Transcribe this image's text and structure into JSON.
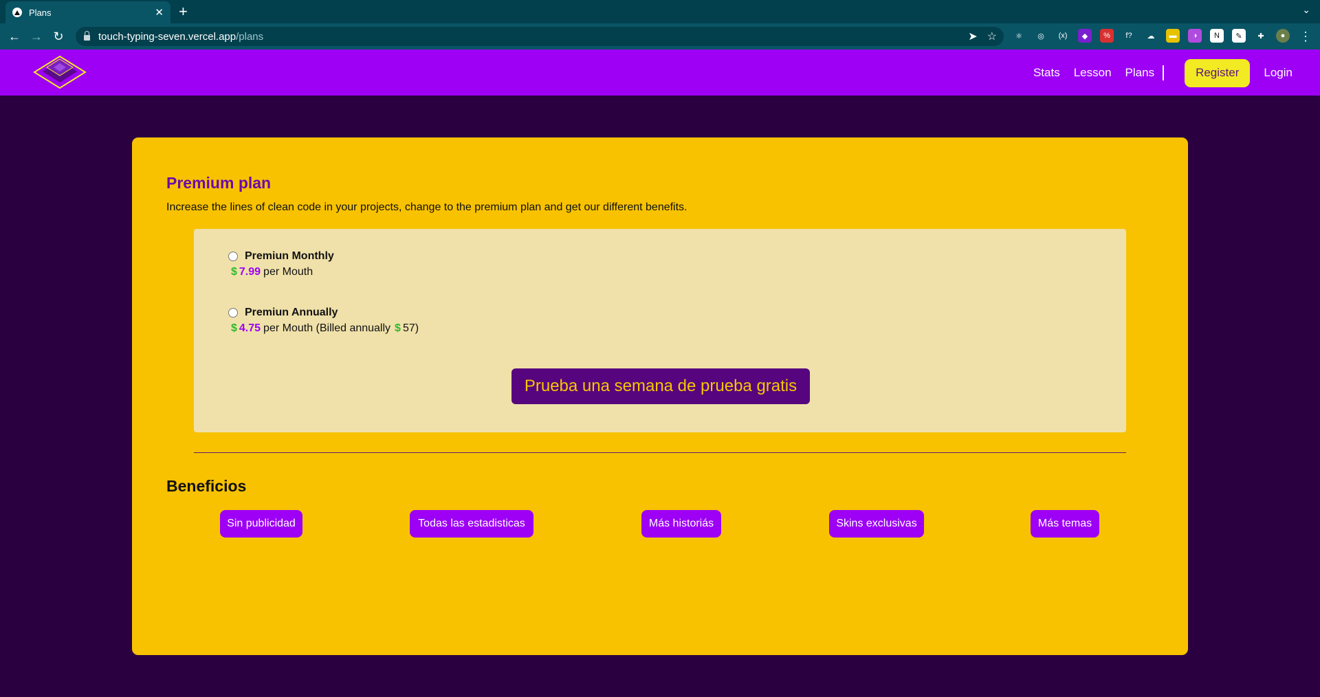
{
  "browser": {
    "tab_title": "Plans",
    "new_tab_symbol": "+",
    "tab_close_symbol": "✕",
    "url_host": "touch-typing-seven.vercel.app",
    "url_path": "/plans",
    "extensions": [
      {
        "name": "react-devtools-icon",
        "color": "#0a5565",
        "glyph": "⚛"
      },
      {
        "name": "circle-ext-icon",
        "color": "#0a5565",
        "glyph": "◎"
      },
      {
        "name": "vars-ext-icon",
        "color": "#0a5565",
        "glyph": "(x)"
      },
      {
        "name": "purple-ext-icon",
        "color": "#7a1fd0",
        "glyph": "◆"
      },
      {
        "name": "percent-ext-icon",
        "color": "#d93030",
        "glyph": "%"
      },
      {
        "name": "formula-ext-icon",
        "color": "#0a5565",
        "glyph": "f?"
      },
      {
        "name": "cloud-ext-icon",
        "color": "#0a5565",
        "glyph": "☁"
      },
      {
        "name": "yellow-ext-icon",
        "color": "#e6c200",
        "glyph": "▬"
      },
      {
        "name": "gradient-ext-icon",
        "color": "#b04be0",
        "glyph": "◑"
      },
      {
        "name": "notion-icon",
        "color": "#ffffff",
        "glyph": "N"
      },
      {
        "name": "edit-ext-icon",
        "color": "#ffffff",
        "glyph": "✎"
      },
      {
        "name": "puzzle-icon",
        "color": "#0a5565",
        "glyph": "✚"
      },
      {
        "name": "profile-avatar",
        "color": "#6a7f4a",
        "glyph": "●"
      }
    ]
  },
  "header": {
    "nav": {
      "stats": "Stats",
      "lesson": "Lesson",
      "plans": "Plans",
      "register": "Register",
      "login": "Login"
    }
  },
  "plan": {
    "title": "Premium plan",
    "description": "Increase the lines of clean code in your projects, change to the premium plan and get our different benefits.",
    "options": [
      {
        "name": "Premiun Monthly",
        "currency": "$",
        "price": "7.99",
        "suffix": "per Mouth"
      },
      {
        "name": "Premiun Annually",
        "currency": "$",
        "price": "4.75",
        "suffix": "per Mouth (Billed annually",
        "billed_currency": "$",
        "billed_amount": "57)"
      }
    ],
    "trial_button": "Prueba una semana de prueba gratis"
  },
  "benefits": {
    "title": "Beneficios",
    "items": [
      "Sin publicidad",
      "Todas las estadisticas",
      "Más historiás",
      "Skins exclusivas",
      "Más temas"
    ]
  },
  "colors": {
    "page_bg": "#2a0040",
    "header_bg": "#9d00f5",
    "card_bg": "#f8c200",
    "accent_purple": "#9d00f5",
    "register_bg": "#f2ea22"
  }
}
